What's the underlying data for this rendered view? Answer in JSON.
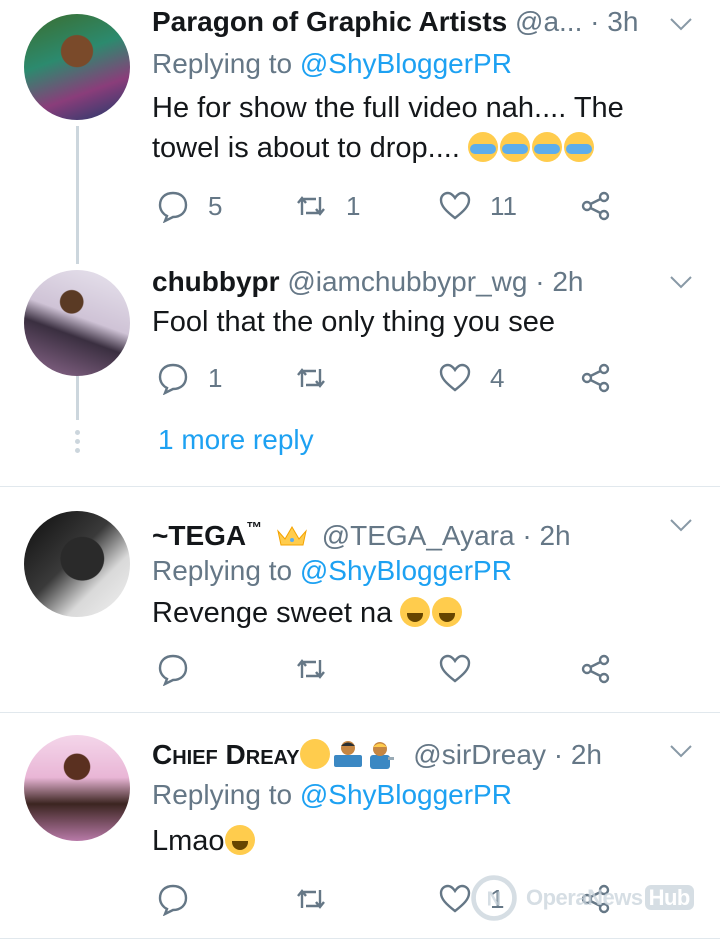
{
  "tweets": [
    {
      "name": "Paragon of Graphic Artists",
      "handle": "@a...",
      "time": "3h",
      "replying_prefix": "Replying to",
      "replying_to": "@ShyBloggerPR",
      "text_line1": "He for show the full video nah.... The",
      "text_line2": "towel is about to drop....",
      "emojis": [
        "loudly-crying-face",
        "loudly-crying-face",
        "loudly-crying-face",
        "loudly-crying-face"
      ],
      "replies": "5",
      "retweets": "1",
      "likes": "11"
    },
    {
      "name": "chubbypr",
      "handle": "@iamchubbypr_wg",
      "time": "2h",
      "text": "Fool that the only thing you see",
      "replies": "1",
      "retweets": "",
      "likes": "4",
      "more_reply": "1 more reply"
    },
    {
      "name": "~TEGA",
      "name_mark": "™",
      "name_emoji": "crown",
      "handle": "@TEGA_Ayara",
      "time": "2h",
      "replying_prefix": "Replying to",
      "replying_to": "@ShyBloggerPR",
      "text": "Revenge sweet na",
      "emojis": [
        "face-with-tears-of-joy",
        "face-with-tears-of-joy"
      ],
      "replies": "",
      "retweets": "",
      "likes": ""
    },
    {
      "name": "Chief Dreay",
      "name_emojis": [
        "face-with-medical-mask",
        "technologist",
        "mechanic"
      ],
      "handle": "@sirDreay",
      "time": "2h",
      "replying_prefix": "Replying to",
      "replying_to": "@ShyBloggerPR",
      "text": "Lmao",
      "emojis": [
        "face-with-tears-of-joy"
      ],
      "replies": "",
      "retweets": "",
      "likes": "1"
    }
  ],
  "separator_dot": "·",
  "watermark": {
    "brand": "Opera",
    "news": "News",
    "hub": "Hub"
  },
  "colors": {
    "link": "#1da1f2",
    "secondary": "#657786",
    "border": "#e1e8ed",
    "thread": "#ccd6dd"
  }
}
